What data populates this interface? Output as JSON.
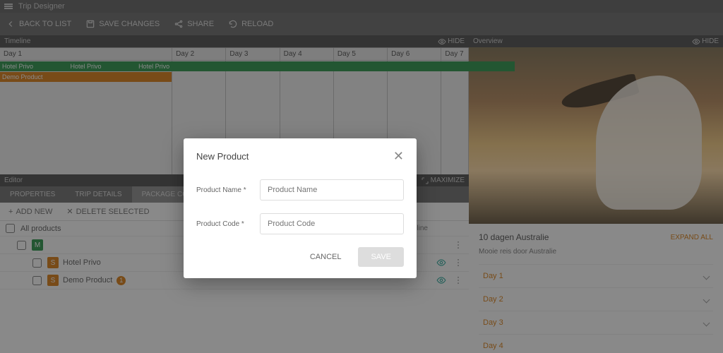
{
  "app": {
    "title": "Trip Designer"
  },
  "toolbar": {
    "back": "BACK TO LIST",
    "save": "SAVE CHANGES",
    "share": "SHARE",
    "reload": "RELOAD"
  },
  "timeline": {
    "title": "Timeline",
    "hide": "HIDE",
    "days": [
      "Day 1",
      "Day 2",
      "Day 3",
      "Day 4",
      "Day 5",
      "Day 6",
      "Day 7"
    ],
    "hotel_label": "Hotel Privo",
    "demo_label": "Demo Product"
  },
  "editor": {
    "title": "Editor",
    "maximize": "MAXIMIZE",
    "tabs": {
      "properties": "PROPERTIES",
      "trip_details": "TRIP DETAILS",
      "package": "PACKAGE CONTENT"
    },
    "add_new": "ADD NEW",
    "delete_selected": "DELETE SELECTED",
    "all_products": "All products",
    "col_timeline": "Timeline",
    "rows": {
      "m_chip": "M",
      "s_chip": "S",
      "hotel": "Hotel Privo",
      "demo": "Demo Product",
      "badge": "1"
    }
  },
  "overview": {
    "title": "Overview",
    "hide": "HIDE",
    "trip_title": "10 dagen Australie",
    "expand_all": "EXPAND ALL",
    "subtitle": "Mooie reis door Australie",
    "days": [
      "Day 1",
      "Day 2",
      "Day 3",
      "Day 4"
    ]
  },
  "modal": {
    "title": "New Product",
    "name_label": "Product Name *",
    "name_placeholder": "Product Name",
    "code_label": "Product Code *",
    "code_placeholder": "Product Code",
    "cancel": "CANCEL",
    "save": "SAVE"
  }
}
